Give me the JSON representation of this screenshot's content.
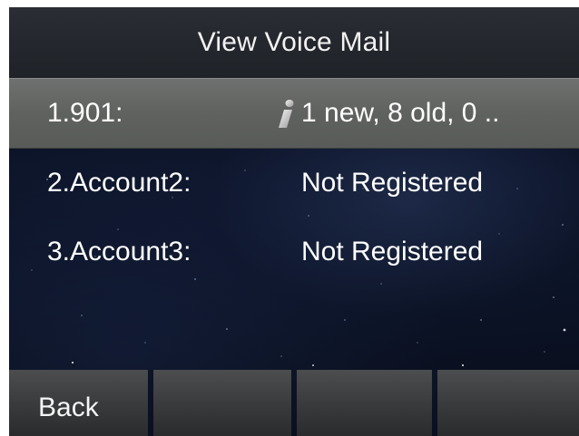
{
  "header": {
    "title": "View Voice Mail"
  },
  "accounts": [
    {
      "label": "1.901:",
      "value": "1 new, 8 old, 0 ..",
      "icon": "info-icon",
      "selected": true
    },
    {
      "label": "2.Account2:",
      "value": "Not Registered",
      "selected": false
    },
    {
      "label": "3.Account3:",
      "value": "Not Registered",
      "selected": false
    }
  ],
  "softkeys": [
    {
      "label": "Back"
    },
    {
      "label": ""
    },
    {
      "label": ""
    },
    {
      "label": ""
    }
  ],
  "colors": {
    "selected_row": "#636663",
    "title_bar": "#25292e",
    "background": "#0b1224"
  }
}
